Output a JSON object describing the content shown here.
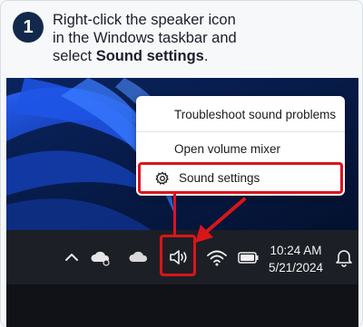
{
  "step": {
    "number": "1"
  },
  "instruction": {
    "line1": "Right-click the speaker icon",
    "line2": "in the Windows taskbar and",
    "line3_prefix": "select ",
    "line3_bold": "Sound settings",
    "line3_suffix": "."
  },
  "context_menu": {
    "items": [
      {
        "label": "Troubleshoot sound problems"
      },
      {
        "label": "Open volume mixer"
      },
      {
        "label": "Sound settings",
        "icon": "gear-icon"
      }
    ]
  },
  "taskbar": {
    "icons": [
      "chevron-up-icon",
      "cloud-icon",
      "cloud-icon",
      "speaker-icon",
      "wifi-icon",
      "battery-icon",
      "bell-icon"
    ],
    "time": "10:24 AM",
    "date": "5/21/2024"
  },
  "colors": {
    "highlight": "#d9151b",
    "badge": "#13294b",
    "taskbar": "#1c1f26"
  }
}
